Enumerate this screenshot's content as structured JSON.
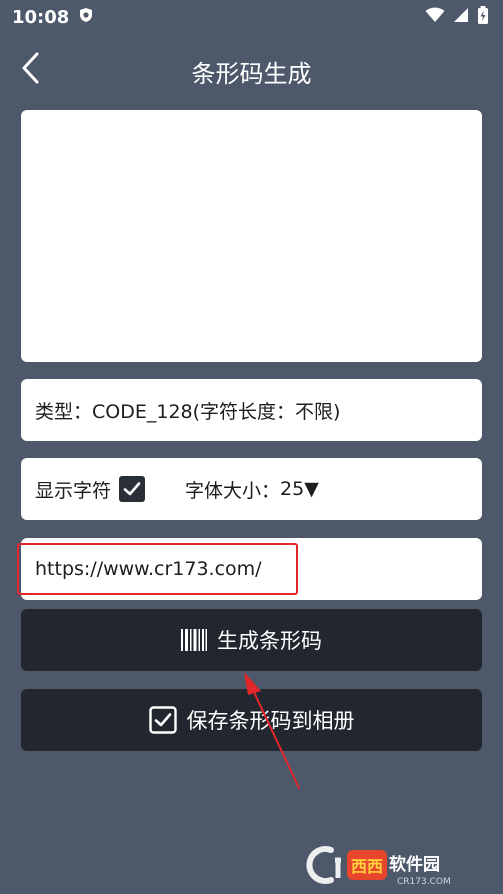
{
  "status_bar": {
    "time": "10:08"
  },
  "header": {
    "title": "条形码生成"
  },
  "type_row": {
    "label": "类型：",
    "value": "CODE_128(字符长度：不限)"
  },
  "options_row": {
    "show_chars_label": "显示字符",
    "show_chars_checked": true,
    "font_size_label": "字体大小：",
    "font_size_value": "25",
    "dropdown_glyph": "▼"
  },
  "url_input": {
    "value": "https://www.cr173.com/"
  },
  "generate_button": {
    "label": "生成条形码",
    "icon": "barcode-icon"
  },
  "save_button": {
    "label": "保存条形码到相册",
    "icon": "checkbox-icon"
  },
  "watermark": {
    "text": "西西软件园",
    "site": "CR173.COM"
  },
  "colors": {
    "background": "#4d586b",
    "card": "#ffffff",
    "button": "#22272f",
    "highlight": "#e3262a"
  }
}
